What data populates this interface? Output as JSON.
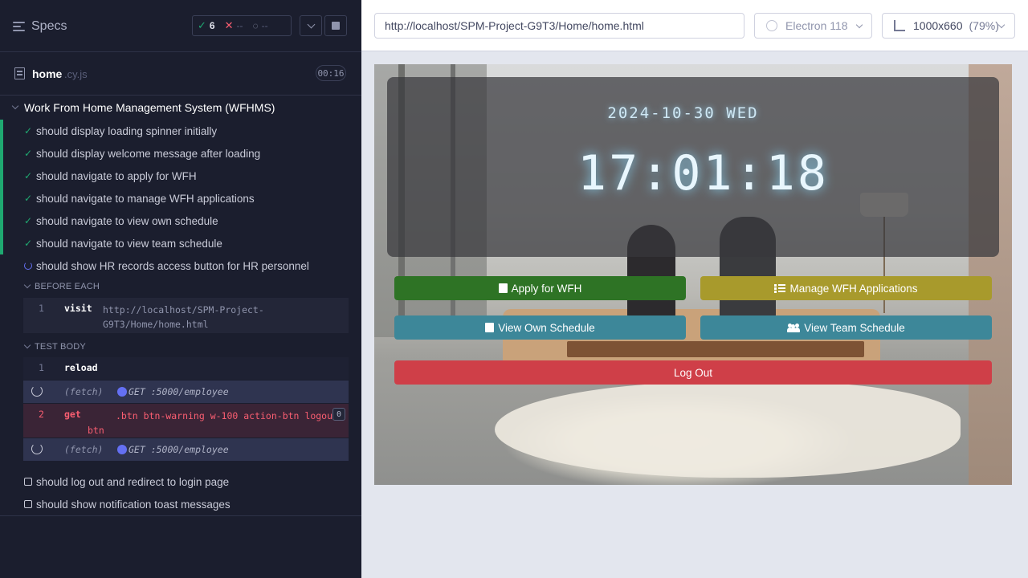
{
  "runner": {
    "specs_label": "Specs",
    "stats": {
      "passed": "6",
      "failed": "--",
      "pending": "--"
    },
    "spec_file": {
      "name": "home",
      "ext": ".cy.js",
      "duration": "00:16"
    },
    "suite_title": "Work From Home Management System (WFHMS)",
    "tests": [
      {
        "label": "should display loading spinner initially",
        "state": "passed"
      },
      {
        "label": "should display welcome message after loading",
        "state": "passed"
      },
      {
        "label": "should navigate to apply for WFH",
        "state": "passed"
      },
      {
        "label": "should navigate to manage WFH applications",
        "state": "passed"
      },
      {
        "label": "should navigate to view own schedule",
        "state": "passed"
      },
      {
        "label": "should navigate to view team schedule",
        "state": "passed"
      },
      {
        "label": "should show HR records access button for HR personnel",
        "state": "running"
      },
      {
        "label": "should log out and redirect to login page",
        "state": "pending"
      },
      {
        "label": "should show notification toast messages",
        "state": "pending"
      }
    ],
    "before_each": {
      "label": "BEFORE EACH",
      "commands": [
        {
          "num": "1",
          "name": "visit",
          "message": "http://localhost/SPM-Project-G9T3/Home/home.html"
        }
      ]
    },
    "test_body": {
      "label": "TEST BODY",
      "commands": [
        {
          "num": "1",
          "name": "reload"
        },
        {
          "type": "(fetch)",
          "message": "GET :5000/employee"
        },
        {
          "num": "2",
          "name": "get",
          "message": ".btn btn-warning w-100 action-btn logout-btn",
          "count": "0"
        },
        {
          "type": "(fetch)",
          "message": "GET :5000/employee"
        }
      ]
    }
  },
  "browser": {
    "url": "http://localhost/SPM-Project-G9T3/Home/home.html",
    "browser_name": "Electron 118",
    "viewport": "1000x660",
    "scale": "(79%)"
  },
  "app": {
    "date": "2024-10-30 WED",
    "time": "17:01:18",
    "buttons": {
      "apply": "Apply for WFH",
      "manage": "Manage WFH Applications",
      "own_schedule": "View Own Schedule",
      "team_schedule": "View Team Schedule",
      "logout": "Log Out"
    }
  },
  "colors": {
    "pass": "#1fa971",
    "fail": "#fa5e71",
    "running": "#6470f3",
    "apply": "#2e7325",
    "manage": "#a89a2c",
    "schedule": "#3d8799",
    "logout": "#cf3f48"
  }
}
